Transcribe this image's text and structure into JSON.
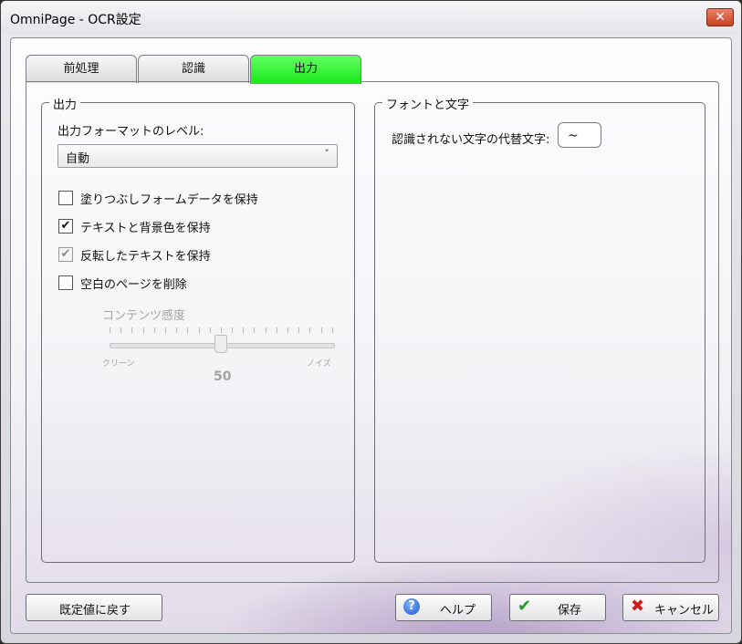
{
  "window": {
    "title": "OmniPage - OCR設定",
    "close_glyph": "✕"
  },
  "tabs": [
    {
      "label": "前処理"
    },
    {
      "label": "認識"
    },
    {
      "label": "出力"
    }
  ],
  "output_group": {
    "legend": "出力",
    "format_level_label": "出力フォーマットのレベル:",
    "format_level_value": "自動",
    "checkboxes": [
      {
        "label": "塗りつぶしフォームデータを保持",
        "checked": false
      },
      {
        "label": "テキストと背景色を保持",
        "checked": true
      },
      {
        "label": "反転したテキストを保持",
        "checked": true
      },
      {
        "label": "空白のページを削除",
        "checked": false
      }
    ],
    "slider": {
      "title": "コンテンツ感度",
      "min_label": "クリーン",
      "max_label": "ノイズ",
      "value": "50",
      "level": 0.5
    }
  },
  "font_group": {
    "legend": "フォントと文字",
    "replace_label": "認識されない文字の代替文字:",
    "replace_value": "~"
  },
  "buttons": {
    "reset": "既定値に戻す",
    "help": "ヘルプ",
    "save": "保存",
    "cancel": "キャンセル"
  },
  "colors": {
    "active_tab": "#33f033",
    "help_icon": "#1c56c8",
    "save_icon": "#1f9a1f",
    "cancel_icon": "#d11b1b"
  }
}
